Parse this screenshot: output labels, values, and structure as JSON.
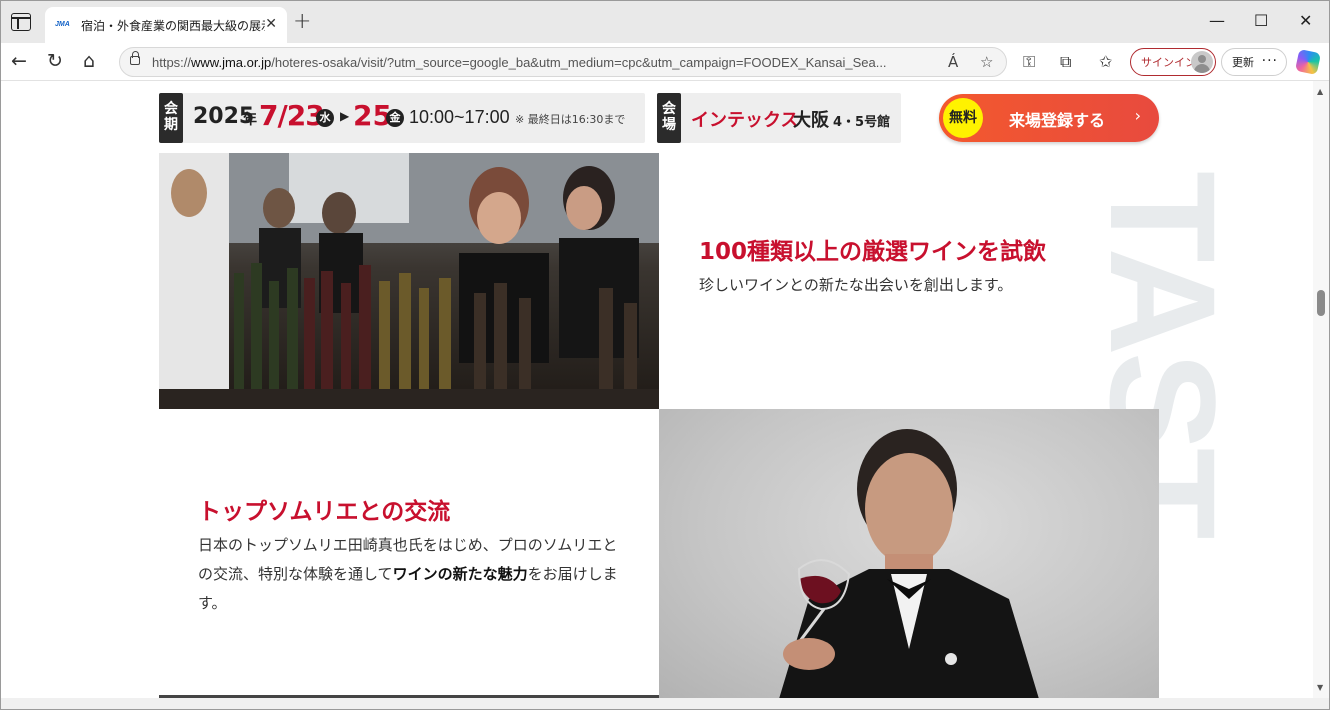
{
  "browser": {
    "tab_title": "宿泊・外食産業の関西最大級の展示",
    "favicon_text": "JMA",
    "new_tab": "+",
    "url_prefix": "https://",
    "url_host": "www.jma.or.jp",
    "url_path": "/hoteres-osaka/visit/?utm_source=google_ba&utm_medium=cpc&utm_campaign=FOODEX_Kansai_Sea...",
    "signin_label": "サインイン",
    "update_label": "更新",
    "read_aloud": "Á"
  },
  "info_bar": {
    "date_tag": "会期",
    "year": "2025",
    "year_suffix": "年",
    "start_date": "7/23",
    "start_dow": "水",
    "end_date": "25",
    "end_dow": "金",
    "hours": "10:00~17:00",
    "note": "※ 最終日は16:30まで",
    "venue_tag": "会場",
    "venue_name": "インテックス",
    "venue_city": "大阪",
    "venue_hall": "4・5号館"
  },
  "register": {
    "badge": "無料",
    "label": "来場登録する",
    "chevron": "›"
  },
  "features": [
    {
      "title": "100種類以上の厳選ワインを試飲",
      "desc": "珍しいワインとの新たな出会いを創出します。"
    },
    {
      "title": "トップソムリエとの交流",
      "desc_before": "日本のトップソムリエ田崎真也氏をはじめ、プロのソムリエとの交流、特別な体験を通して",
      "desc_bold": "ワインの新たな魅力",
      "desc_after": "をお届けします。"
    }
  ],
  "watermark": "NE TAST",
  "colors": {
    "accent_red": "#c8102e",
    "button_orange": "#f3592e",
    "badge_yellow": "#fff200"
  }
}
